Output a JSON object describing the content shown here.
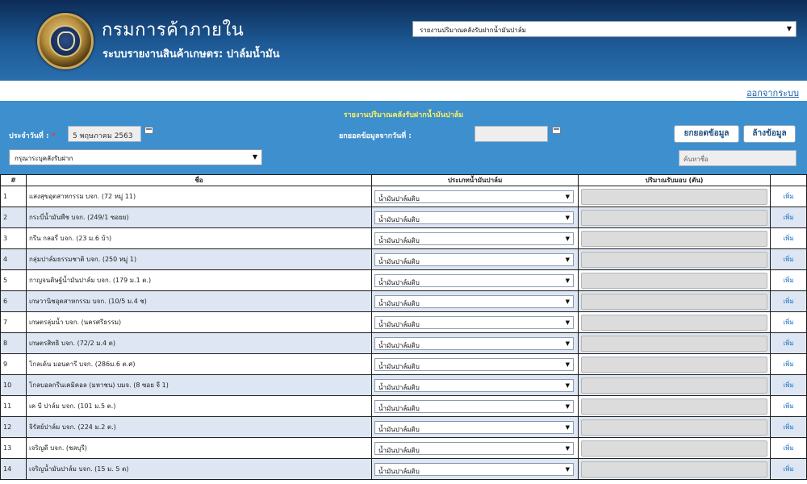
{
  "header": {
    "title": "กรมการค้าภายใน",
    "subtitle": "ระบบรายงานสินค้าเกษตร: ปาล์มน้ำมัน",
    "report_select_value": "รายงานปริมาณคลังรับฝากน้ำมันปาล์ม"
  },
  "logout_label": "ออกจากระบบ",
  "panel": {
    "title": "รายงานปริมาณคลังรับฝากน้ำมันปาล์ม",
    "date_label": "ประจำวันที่ :",
    "required_mark": "*",
    "date_value": "5 พฤษภาคม 2563",
    "carry_label": "ยกยอดข้อมูลจากวันที่ :",
    "carry_value": "",
    "carry_button": "ยกยอดข้อมูล",
    "clear_button": "ล้างข้อมูล",
    "warehouse_placeholder": "กรุณาระบุคลังรับฝาก",
    "search_placeholder": "ค้นหาชื่อ"
  },
  "table": {
    "headers": [
      "#",
      "ชื่อ",
      "ประเภทน้ำมันปาล์ม",
      "ปริมาณรับมอบ (ตัน)",
      ""
    ],
    "add_label": "เพิ่ม",
    "rows": [
      {
        "num": "1",
        "name": "แสงสุขอุตสาหกรรม บจก. (72 หมู่ 11)",
        "type": "น้ำมันปาล์มดิบ"
      },
      {
        "num": "2",
        "name": "กระบี่น้ำมันพืช บจก. (249/1 ซอยย)",
        "type": "น้ำมันปาล์มดิบ"
      },
      {
        "num": "3",
        "name": "กรีน กลอรี่ บจก. (23 ม.6 บ้า)",
        "type": "น้ำมันปาล์มดิบ"
      },
      {
        "num": "4",
        "name": "กลุ่มปาล์มธรรมชาติ บจก. (250 หมู่ 1)",
        "type": "น้ำมันปาล์มดิบ"
      },
      {
        "num": "5",
        "name": "กาญจนดิษฐ์น้ำมันปาล์ม บจก. (179 ม.1 ต.)",
        "type": "น้ำมันปาล์มดิบ"
      },
      {
        "num": "6",
        "name": "เกษวานิชอุตสาหกรรม บจก. (10/5 ม.4 ช)",
        "type": "น้ำมันปาล์มดิบ"
      },
      {
        "num": "7",
        "name": "เกษตรลุ่มน้ำ บจก. (นครศรีธรรม)",
        "type": "น้ำมันปาล์มดิบ"
      },
      {
        "num": "8",
        "name": "เกษตรสิทธิ บจก. (72/2 ม.4 ต)",
        "type": "น้ำมันปาล์มดิบ"
      },
      {
        "num": "9",
        "name": "โกลเด้น มอนตารี บจก. (286ม.6 ต.ศ)",
        "type": "น้ำมันปาล์มดิบ"
      },
      {
        "num": "10",
        "name": "โกลบอลกรีนเคมิคอล (มหาชน) บมจ. (8 ซอย จี 1)",
        "type": "น้ำมันปาล์มดิบ"
      },
      {
        "num": "11",
        "name": "เค บี ปาล์ม บจก. (101 ม.5 ต.)",
        "type": "น้ำมันปาล์มดิบ"
      },
      {
        "num": "12",
        "name": "จิรัสย์ปาล์ม บจก. (224 ม.2 ต.)",
        "type": "น้ำมันปาล์มดิบ"
      },
      {
        "num": "13",
        "name": "เจริญดี บจก. (ชลบุรี)",
        "type": "น้ำมันปาล์มดิบ"
      },
      {
        "num": "14",
        "name": "เจริญน้ำมันปาล์ม บจก. (15 ม. 5 ต)",
        "type": "น้ำมันปาล์มดิบ"
      }
    ]
  }
}
